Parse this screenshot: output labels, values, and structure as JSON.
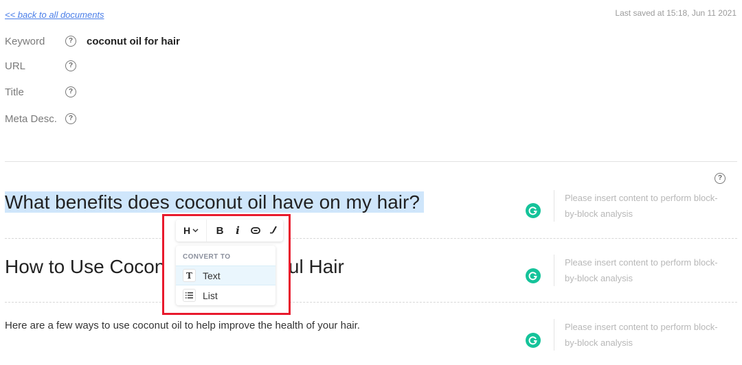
{
  "header": {
    "back_link": "<< back to all documents",
    "last_saved": "Last saved at 15:18, Jun 11 2021"
  },
  "meta": {
    "fields": [
      {
        "label": "Keyword",
        "value": "coconut oil for hair"
      },
      {
        "label": "URL",
        "value": ""
      },
      {
        "label": "Title",
        "value": ""
      },
      {
        "label": "Meta Desc.",
        "value": ""
      }
    ],
    "help_glyph": "?"
  },
  "editor": {
    "blocks": [
      {
        "type": "heading",
        "text": "What benefits does coconut oil have on my hair?",
        "selected": true
      },
      {
        "type": "heading",
        "text_left": "How to Use Cocon",
        "text_right": "eautiful Hair"
      },
      {
        "type": "paragraph",
        "text": "Here are a few ways to use coconut oil to help improve the health of your hair."
      }
    ],
    "analysis_message": "Please insert content to perform block-by-block analysis",
    "analysis_line1": "Please insert content to perform block-",
    "analysis_line2": "by-block analysis",
    "analysis_icon": "grammarly-g-icon"
  },
  "toolbar": {
    "heading_label": "H",
    "heading_chevron": "⌄",
    "bold_label": "B",
    "italic_label": "i",
    "link_icon": "link-icon",
    "clear_format_icon": "clear-format-icon"
  },
  "convert_menu": {
    "title": "CONVERT TO",
    "items": [
      {
        "label": "Text",
        "icon": "T",
        "active": true
      },
      {
        "label": "List",
        "icon": "list-icon",
        "active": false
      }
    ]
  },
  "colors": {
    "accent_link": "#4a7ee8",
    "selection": "#cfe6fb",
    "grammarly_green": "#15c39a",
    "highlight_red": "#e8192c"
  }
}
